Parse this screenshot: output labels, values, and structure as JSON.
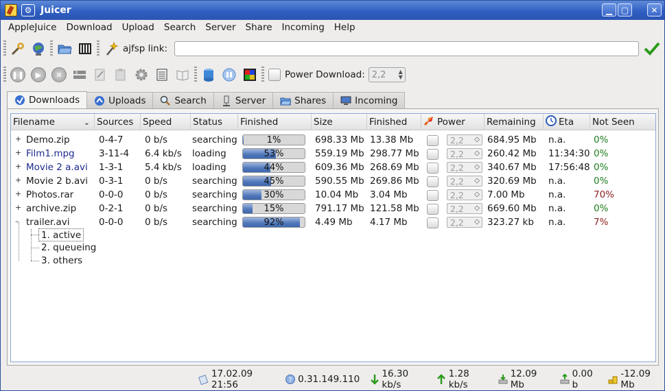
{
  "app": {
    "title": "Juicer"
  },
  "menu": [
    "AppleJuice",
    "Download",
    "Upload",
    "Search",
    "Server",
    "Share",
    "Incoming",
    "Help"
  ],
  "toolbar": {
    "ajfsp_label": "ajfsp link:",
    "ajfsp_value": "",
    "power_label": "Power Download:",
    "power_value": "2,2"
  },
  "tabs": [
    {
      "label": "Downloads",
      "icon": "download-icon"
    },
    {
      "label": "Uploads",
      "icon": "upload-icon"
    },
    {
      "label": "Search",
      "icon": "search-icon"
    },
    {
      "label": "Server",
      "icon": "server-icon"
    },
    {
      "label": "Shares",
      "icon": "shares-folder-icon"
    },
    {
      "label": "Incoming",
      "icon": "incoming-monitor-icon"
    }
  ],
  "columns": [
    "Filename",
    "Sources",
    "Speed",
    "Status",
    "Finished",
    "Size",
    "Finished",
    "Power",
    "Remaining",
    "Eta",
    "Not Seen"
  ],
  "rows": [
    {
      "name": "Demo.zip",
      "sources": "0-4-7",
      "speed": "0 b/s",
      "status": "searching",
      "pct": 1,
      "pct_label": "1%",
      "size": "698.33 Mb",
      "finished": "13.38 Mb",
      "power": "2,2",
      "remaining": "684.95 Mb",
      "eta": "n.a.",
      "notseen": "0%",
      "link": false,
      "seen_color": "#1d7d1d"
    },
    {
      "name": "Film1.mpg",
      "sources": "3-11-4",
      "speed": "6.4 kb/s",
      "status": "loading",
      "pct": 53,
      "pct_label": "53%",
      "size": "559.19 Mb",
      "finished": "298.77 Mb",
      "power": "2,2",
      "remaining": "260.42 Mb",
      "eta": "11:34:30",
      "notseen": "0%",
      "link": true,
      "seen_color": "#1d7d1d"
    },
    {
      "name": "Movie 2 a.avi",
      "sources": "1-3-1",
      "speed": "5.4 kb/s",
      "status": "loading",
      "pct": 44,
      "pct_label": "44%",
      "size": "609.36 Mb",
      "finished": "268.69 Mb",
      "power": "2,2",
      "remaining": "340.67 Mb",
      "eta": "17:56:48",
      "notseen": "0%",
      "link": true,
      "seen_color": "#1d7d1d"
    },
    {
      "name": "Movie 2 b.avi",
      "sources": "0-3-1",
      "speed": "0 b/s",
      "status": "searching",
      "pct": 45,
      "pct_label": "45%",
      "size": "590.55 Mb",
      "finished": "269.86 Mb",
      "power": "2,2",
      "remaining": "320.69 Mb",
      "eta": "n.a.",
      "notseen": "0%",
      "link": false,
      "seen_color": "#1d7d1d"
    },
    {
      "name": "Photos.rar",
      "sources": "0-0-0",
      "speed": "0 b/s",
      "status": "searching",
      "pct": 30,
      "pct_label": "30%",
      "size": "10.04 Mb",
      "finished": "3.04 Mb",
      "power": "2,2",
      "remaining": "7.00 Mb",
      "eta": "n.a.",
      "notseen": "70%",
      "link": false,
      "seen_color": "#8a1d1d"
    },
    {
      "name": "archive.zip",
      "sources": "0-2-1",
      "speed": "0 b/s",
      "status": "searching",
      "pct": 15,
      "pct_label": "15%",
      "size": "791.17 Mb",
      "finished": "121.58 Mb",
      "power": "2,2",
      "remaining": "669.60 Mb",
      "eta": "n.a.",
      "notseen": "0%",
      "link": false,
      "seen_color": "#1d7d1d"
    },
    {
      "name": "trailer.avi",
      "sources": "0-0-0",
      "speed": "0 b/s",
      "status": "searching",
      "pct": 92,
      "pct_label": "92%",
      "size": "4.49 Mb",
      "finished": "4.17 Mb",
      "power": "2,2",
      "remaining": "323.27 kb",
      "eta": "n.a.",
      "notseen": "7%",
      "link": false,
      "seen_color": "#8a1d1d"
    }
  ],
  "subitems": [
    "1. active",
    "2. queueing",
    "3. others"
  ],
  "status": {
    "time": "17.02.09 21:56",
    "version": "0.31.149.110",
    "down": "16.30 kb/s",
    "up": "1.28 kb/s",
    "downloaded": "12.09 Mb",
    "uploaded": "0.00 b",
    "credits": "-12.09 Mb"
  }
}
